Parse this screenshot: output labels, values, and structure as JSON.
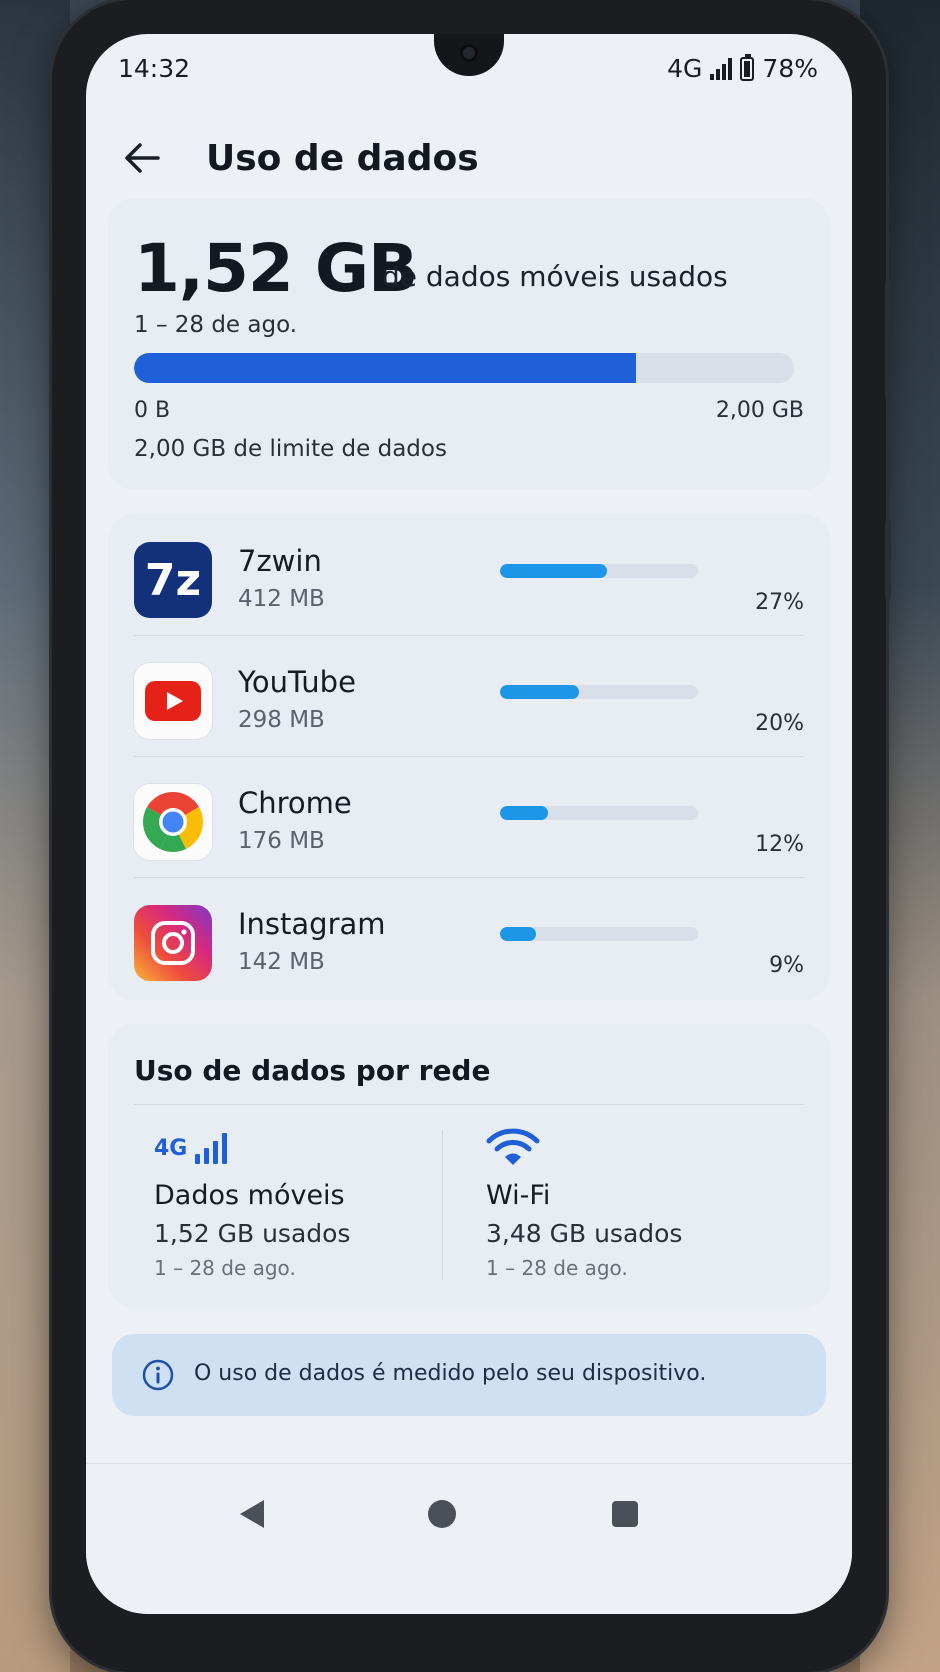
{
  "status_bar": {
    "time": "14:32",
    "network": "4G",
    "battery": "78%"
  },
  "header": {
    "title": "Uso de dados"
  },
  "summary": {
    "amount": "1,52 GB",
    "suffix": "de dados móveis usados",
    "period": "1 – 28 de ago.",
    "bar_min": "0 B",
    "bar_max": "2,00 GB",
    "limit_label": "2,00 GB de limite de dados",
    "used_fraction": 0.76
  },
  "apps": [
    {
      "name": "7zwin",
      "size": "412 MB",
      "percent_label": "27%",
      "fraction": 0.27,
      "icon": "7z-icon",
      "icon_text": "7z"
    },
    {
      "name": "YouTube",
      "size": "298 MB",
      "percent_label": "20%",
      "fraction": 0.2,
      "icon": "youtube-icon"
    },
    {
      "name": "Chrome",
      "size": "176 MB",
      "percent_label": "12%",
      "fraction": 0.12,
      "icon": "chrome-icon"
    },
    {
      "name": "Instagram",
      "size": "142 MB",
      "percent_label": "9%",
      "fraction": 0.09,
      "icon": "instagram-icon"
    }
  ],
  "network": {
    "title": "Uso de dados por rede",
    "mobile": {
      "badge": "4G",
      "name": "Dados móveis",
      "used": "1,52 GB usados",
      "period": "1 – 28 de ago."
    },
    "wifi": {
      "name": "Wi-Fi",
      "used": "3,48 GB usados",
      "period": "1 – 28 de ago."
    }
  },
  "info": {
    "text": "O uso de dados é medido pelo seu dispositivo."
  },
  "colors": {
    "primary_bar": "#1f5fd7",
    "app_bar": "#1e96e8",
    "network_accent": "#1f5fd7"
  }
}
